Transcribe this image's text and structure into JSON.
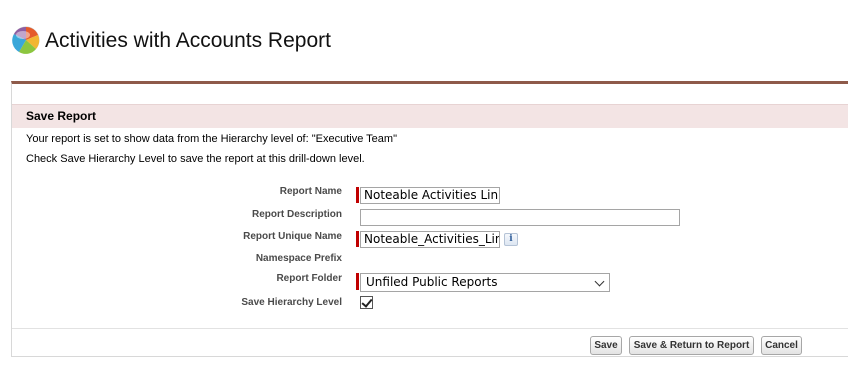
{
  "header": {
    "title": "Activities with Accounts Report"
  },
  "section": {
    "title": "Save Report",
    "info_line_1": "Your report is set to show data from the Hierarchy level of: \"Executive Team\"",
    "info_line_2": "Check Save Hierarchy Level to save the report at this drill-down level."
  },
  "form": {
    "report_name": {
      "label": "Report Name",
      "value": "Noteable Activities Link",
      "required": true
    },
    "report_description": {
      "label": "Report Description",
      "value": ""
    },
    "report_unique_name": {
      "label": "Report Unique Name",
      "value": "Noteable_Activities_Link",
      "required": true,
      "info": "i"
    },
    "namespace_prefix": {
      "label": "Namespace Prefix"
    },
    "report_folder": {
      "label": "Report Folder",
      "selected": "Unfiled Public Reports",
      "required": true
    },
    "save_hierarchy_level": {
      "label": "Save Hierarchy Level",
      "checked": true
    }
  },
  "buttons": {
    "save": "Save",
    "save_return": "Save & Return to Report",
    "cancel": "Cancel"
  },
  "colors": {
    "required_bar": "#c00000",
    "section_header_bg": "#f3e4e4",
    "panel_top_border": "#8e5a4a"
  },
  "icons": [
    "app-logo-icon",
    "info-icon",
    "chevron-down-icon",
    "check-icon"
  ]
}
